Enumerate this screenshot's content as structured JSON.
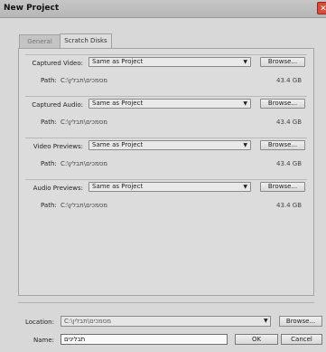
{
  "window": {
    "title": "New Project",
    "close_glyph": "✕"
  },
  "tabs": [
    {
      "label": "General",
      "active": false
    },
    {
      "label": "Scratch Disks",
      "active": true
    }
  ],
  "scratch": {
    "path_label": "Path:",
    "browse_label": "Browse...",
    "rows": [
      {
        "label": "Captured Video:",
        "selected": "Same as Project",
        "path": "C:\\מסמכים\\תבלין",
        "size": "43.4 GB"
      },
      {
        "label": "Captured Audio:",
        "selected": "Same as Project",
        "path": "C:\\מסמכים\\תבלין",
        "size": "43.4 GB"
      },
      {
        "label": "Video Previews:",
        "selected": "Same as Project",
        "path": "C:\\מסמכים\\תבלין",
        "size": "43.4 GB"
      },
      {
        "label": "Audio Previews:",
        "selected": "Same as Project",
        "path": "C:\\מסמכים\\תבלין",
        "size": "43.4 GB"
      }
    ]
  },
  "footer": {
    "location_label": "Location:",
    "location_value": "C:\\מסמכים\\תבלין",
    "browse_label": "Browse...",
    "name_label": "Name:",
    "name_value": "תבלינים",
    "ok_label": "OK",
    "cancel_label": "Cancel"
  },
  "icons": {
    "dropdown_arrow": "▼",
    "close": "close-icon"
  },
  "colors": {
    "close_button": "#d84a3a",
    "panel_bg": "#dcdcdc",
    "window_bg": "#d8d8d8"
  }
}
